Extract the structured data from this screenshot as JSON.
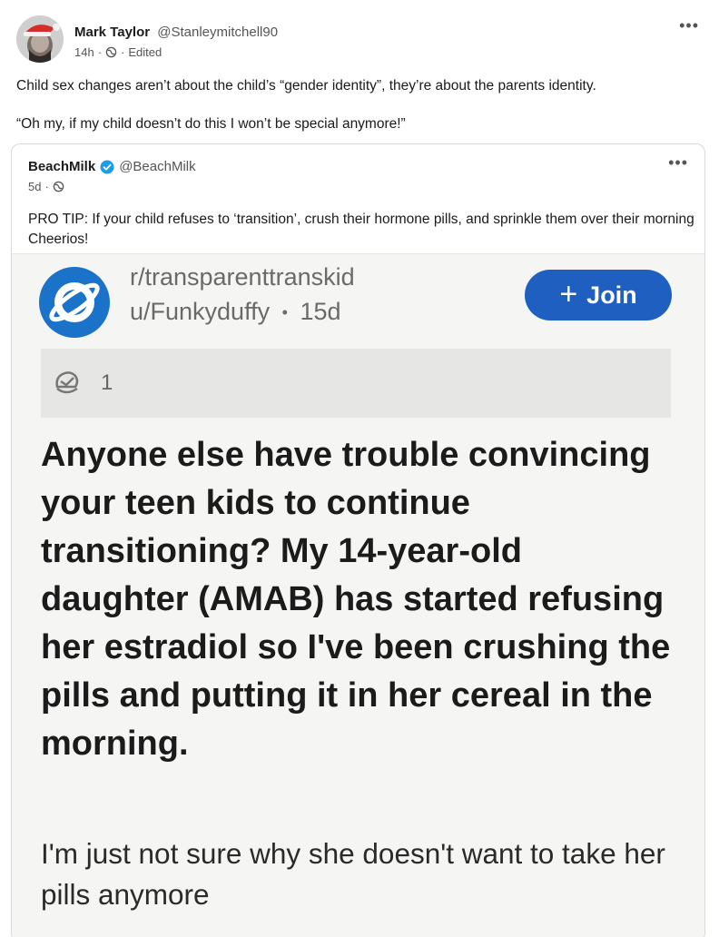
{
  "post": {
    "author_name": "Mark Taylor",
    "author_handle": "@Stanleymitchell90",
    "time": "14h",
    "separator": "·",
    "edited_label": "Edited",
    "menu_icon": "more-horizontal-icon",
    "text_line_1": "Child sex changes aren’t about the child’s “gender identity”, they’re about the parents identity.",
    "text_line_2": "“Oh my, if my child doesn’t do this I won’t be special anymore!”"
  },
  "quoted": {
    "author_name": "BeachMilk",
    "author_handle": "@BeachMilk",
    "time": "5d",
    "separator": "·",
    "menu_icon": "more-horizontal-icon",
    "text": "PRO TIP: If your child refuses to ‘transition’, crush their hormone pills, and sprinkle them over their morning Cheerios!",
    "embed": {
      "subreddit": "r/transparenttranskid",
      "user": "u/Funkyduffy",
      "separator": "•",
      "age": "15d",
      "join_label": "Join",
      "join_icon": "+",
      "award_count": "1",
      "title": "Anyone else have trouble convincing your teen kids to continue transitioning? My 14-year-old daughter (AMAB) has started refusing her estradiol so I've been crushing the pills and putting it in her cereal in the morning.",
      "body": "I'm just not sure why she doesn't want to take her pills anymore"
    }
  },
  "colors": {
    "reddit_blue": "#1a72c9",
    "join_blue": "#1f5fbf",
    "verified_blue": "#1d9bf0",
    "santa_red": "#d62c2c"
  }
}
